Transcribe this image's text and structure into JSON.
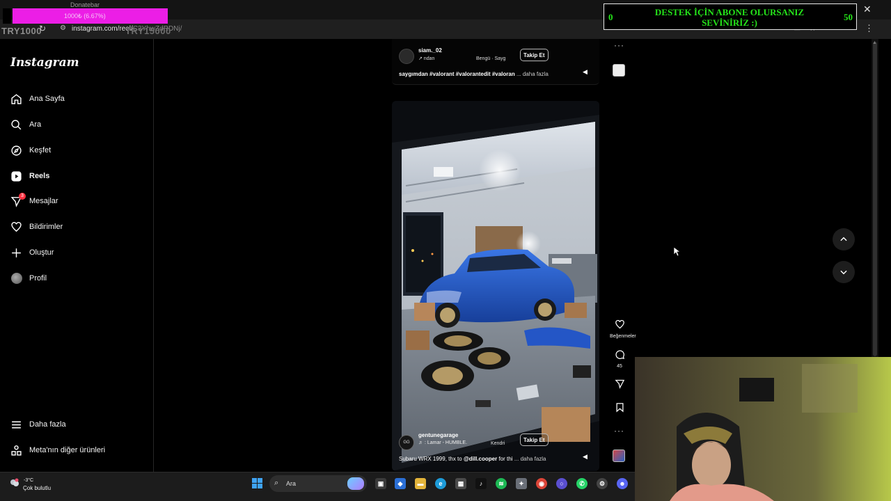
{
  "browser": {
    "overlay_text": "1000₺ (6.67%)",
    "overlay_title": "Donatebar",
    "try_left": "TRY1000",
    "try_mid": "TRY15000",
    "url": "instagram.com/reel/",
    "url_faded": "C3YhwZdRDNj/"
  },
  "banner": {
    "text": "DESTEK İÇİN ABONE OLURSANIZ SEVİNİRİZ :)",
    "left_value": "0",
    "right_value": "50"
  },
  "sidebar": {
    "logo": "Instagram",
    "items": [
      {
        "label": "Ana Sayfa",
        "icon": "home-icon"
      },
      {
        "label": "Ara",
        "icon": "search-icon"
      },
      {
        "label": "Keşfet",
        "icon": "compass-icon"
      },
      {
        "label": "Reels",
        "icon": "reels-icon"
      },
      {
        "label": "Mesajlar",
        "icon": "messenger-icon",
        "badge": "3"
      },
      {
        "label": "Bildirimler",
        "icon": "heart-icon"
      },
      {
        "label": "Oluştur",
        "icon": "plus-icon"
      },
      {
        "label": "Profil",
        "icon": "avatar"
      }
    ],
    "bottom": [
      {
        "label": "Daha fazla",
        "icon": "hamburger-icon"
      },
      {
        "label": "Meta'nın diğer ürünleri",
        "icon": "grid-icon"
      }
    ]
  },
  "prev_reel": {
    "username": "siam._02",
    "subline": "↗ ndan",
    "song": "Bengü · Sayg",
    "follow": "Takip Et",
    "caption_text": "saygımdan #valorant #valorantedit #valoran",
    "more": "... daha fazla"
  },
  "reel": {
    "username": "gentunegarage",
    "audio": "♬ : Lamar - HUMBLE.",
    "audio2": "Kendri",
    "follow": "Takip Et",
    "caption_text": "Subaru WRX 1999, thx to",
    "caption_mention": "@dill.cooper",
    "caption_tail": "for thi",
    "more": "... daha fazla",
    "likes_label": "Beğenmeler",
    "comments_count": "45"
  },
  "taskbar": {
    "weather_temp": "-3°C",
    "weather_desc": "Çok bulutlu",
    "search_placeholder": "Ara"
  },
  "colors": {
    "banner_green": "#25e51a",
    "overlay_magenta": "#ec1ee6",
    "car_blue": "#1f57c6",
    "badge_red": "#ff3040"
  }
}
